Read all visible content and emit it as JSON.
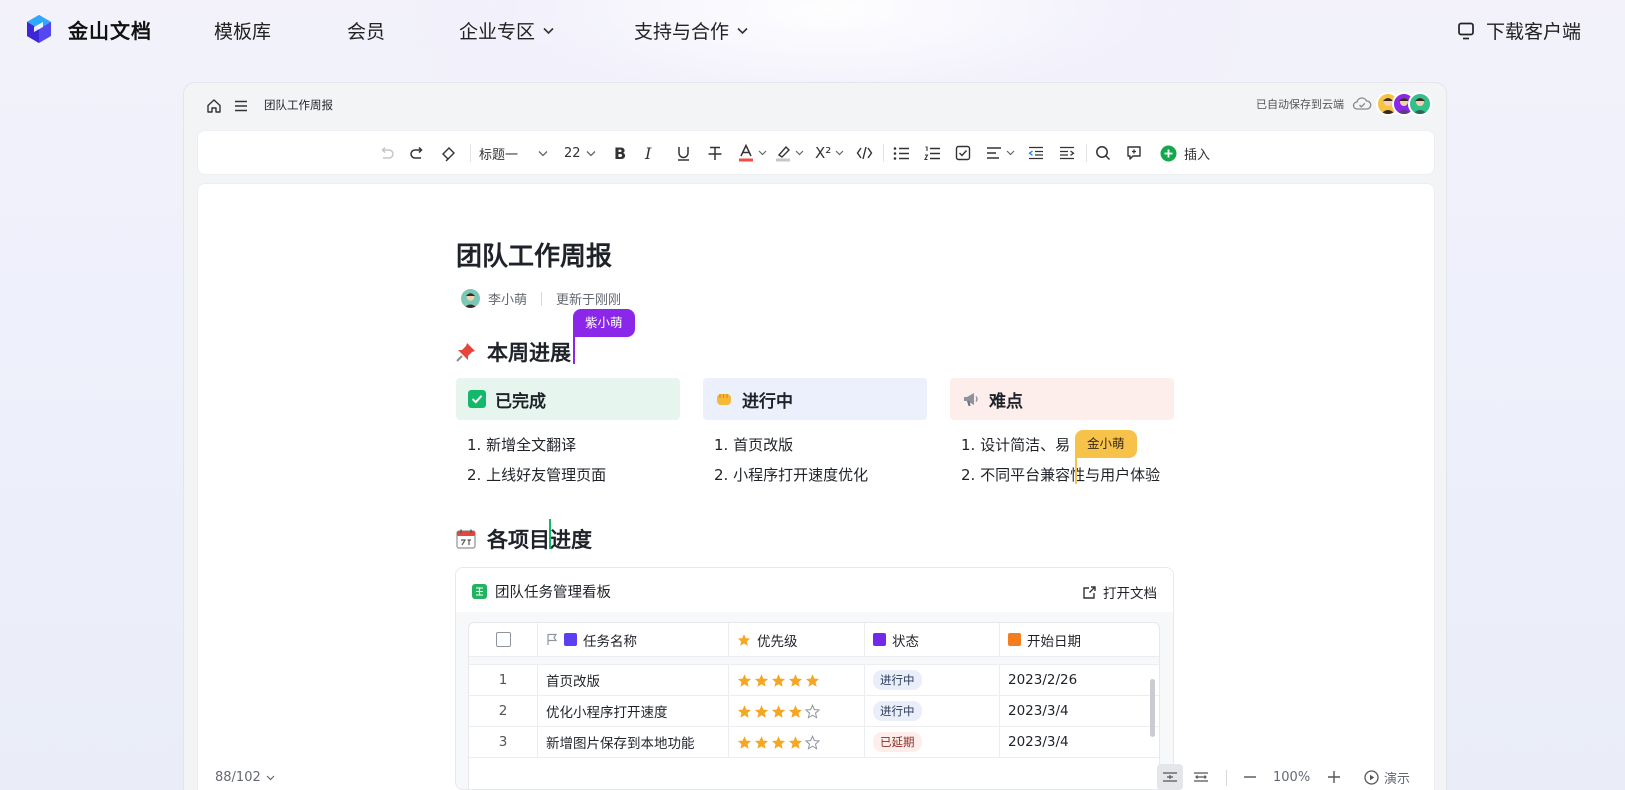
{
  "nav": {
    "brand": "金山文档",
    "items": [
      {
        "label": "模板库"
      },
      {
        "label": "会员"
      },
      {
        "label": "企业专区"
      },
      {
        "label": "支持与合作"
      }
    ],
    "download": "下载客户端"
  },
  "titlebar": {
    "doc_name": "团队工作周报",
    "saved_status": "已自动保存到云端"
  },
  "toolbar": {
    "heading_style": "标题一",
    "font_size": "22",
    "insert_label": "插入"
  },
  "doc": {
    "title": "团队工作周报",
    "author": "李小萌",
    "updated": "更新于刚刚",
    "section1": "本周进展",
    "section2": "各项目进度",
    "cursors": [
      {
        "name": "紫小萌",
        "color": "#8a27e8"
      },
      {
        "name": "金小萌",
        "color": "#f7c24a"
      }
    ],
    "cards": [
      {
        "title": "已完成",
        "bg": "#e6f6ef",
        "items": [
          "1.  新增全文翻译",
          "2. 上线好友管理页面"
        ]
      },
      {
        "title": "进行中",
        "bg": "#ecf0fc",
        "items": [
          "1.  首页改版",
          "2. 小程序打开速度优化"
        ]
      },
      {
        "title": "难点",
        "bg": "#fdeeec",
        "items": [
          "1.  设计简洁、易",
          "2. 不同平台兼容性与用户体验"
        ]
      }
    ]
  },
  "embed": {
    "title": "团队任务管理看板",
    "open_label": "打开文档",
    "columns": [
      "任务名称",
      "优先级",
      "状态",
      "开始日期"
    ],
    "rows": [
      {
        "num": "1",
        "name": "首页改版",
        "stars": 5,
        "status": "进行中",
        "status_kind": "progress",
        "date": "2023/2/26"
      },
      {
        "num": "2",
        "name": "优化小程序打开速度",
        "stars": 4,
        "status": "进行中",
        "status_kind": "progress",
        "date": "2023/3/4"
      },
      {
        "num": "3",
        "name": "新增图片保存到本地功能",
        "stars": 4,
        "status": "已延期",
        "status_kind": "delayed",
        "date": "2023/3/4"
      }
    ]
  },
  "statusbar": {
    "word_count": "88/102",
    "zoom": "100%",
    "present_label": "演示"
  },
  "colors": {
    "accent": "#1a7cff",
    "brand": "#3d37e6",
    "purple_cursor": "#8a27e8",
    "gold_cursor": "#f7c24a",
    "star": "#f5a623"
  }
}
